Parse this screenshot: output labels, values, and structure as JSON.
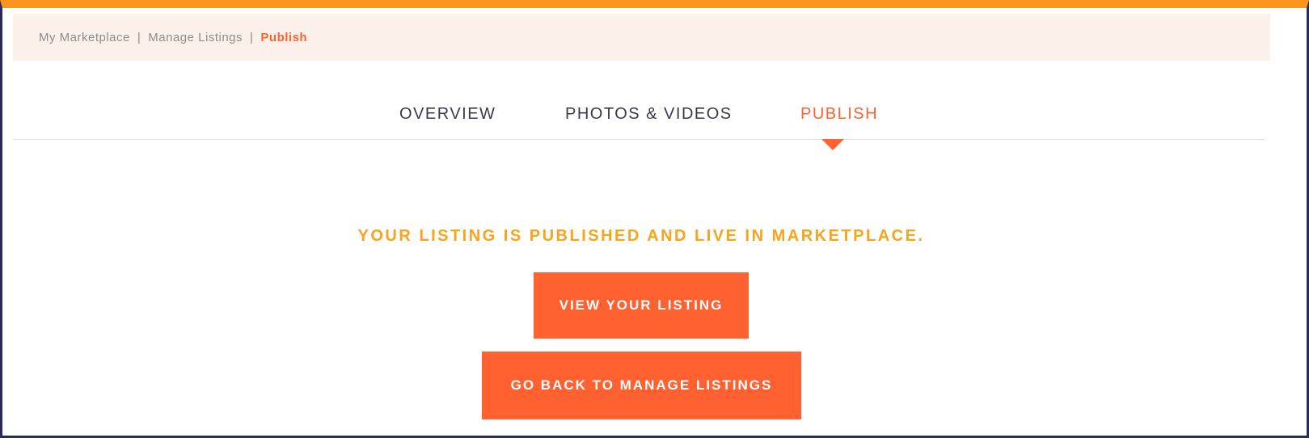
{
  "breadcrumb": {
    "items": [
      {
        "label": "My Marketplace"
      },
      {
        "label": "Manage Listings"
      },
      {
        "label": "Publish"
      }
    ],
    "separator": "|"
  },
  "tabs": [
    {
      "label": "OVERVIEW",
      "active": false
    },
    {
      "label": "PHOTOS & VIDEOS",
      "active": false
    },
    {
      "label": "PUBLISH",
      "active": true
    }
  ],
  "status": {
    "message": "YOUR LISTING IS PUBLISHED AND LIVE IN MARKETPLACE."
  },
  "actions": {
    "view_listing_label": "VIEW YOUR LISTING",
    "back_label": "GO BACK TO MANAGE LISTINGS"
  },
  "colors": {
    "accent": "#ff6131",
    "status_text": "#f6a41c",
    "top_bar": "#f79520",
    "frame": "#2b2a5a",
    "breadcrumb_bg": "#fbf1ea"
  }
}
